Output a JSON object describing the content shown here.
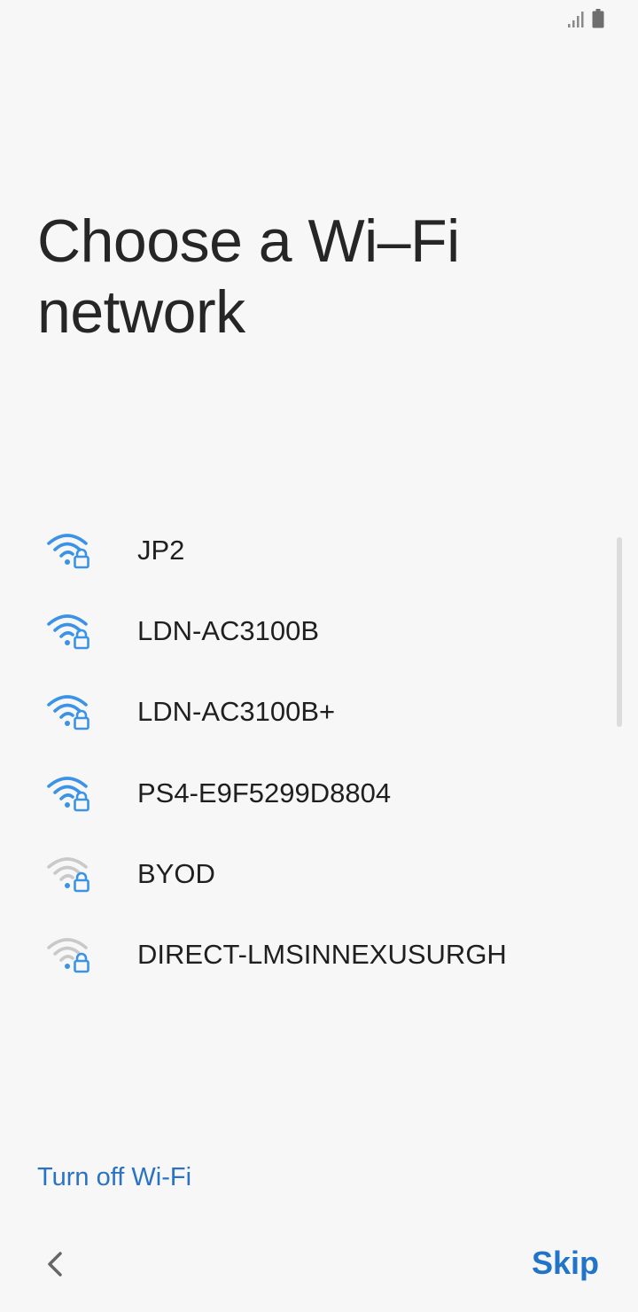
{
  "status_bar": {
    "icons": [
      "signal-icon",
      "battery-icon"
    ]
  },
  "title": "Choose a Wi–Fi network",
  "networks": [
    {
      "name": "JP2",
      "secured": true,
      "signal": "strong",
      "icon": "wifi-lock-icon"
    },
    {
      "name": "LDN-AC3100B",
      "secured": true,
      "signal": "strong",
      "icon": "wifi-lock-icon"
    },
    {
      "name": "LDN-AC3100B+",
      "secured": true,
      "signal": "strong",
      "icon": "wifi-lock-icon"
    },
    {
      "name": "PS4-E9F5299D8804",
      "secured": true,
      "signal": "strong",
      "icon": "wifi-lock-icon"
    },
    {
      "name": "BYOD",
      "secured": true,
      "signal": "weak",
      "icon": "wifi-lock-icon"
    },
    {
      "name": "DIRECT-LMSINNEXUSURGH",
      "secured": true,
      "signal": "weak",
      "icon": "wifi-lock-icon"
    }
  ],
  "footer": {
    "turn_off_label": "Turn off Wi-Fi",
    "back_icon": "chevron-left-icon",
    "skip_label": "Skip"
  },
  "colors": {
    "accent": "#2274c8",
    "wifi_strong": "#3a93e6",
    "wifi_weak_arc": "#c9c9c9",
    "background": "#f7f7f7"
  }
}
